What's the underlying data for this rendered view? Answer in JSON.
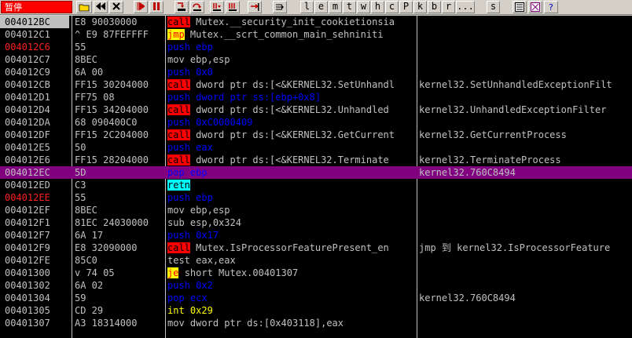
{
  "toolbar": {
    "status_label": "暂停",
    "letter_buttons": [
      "l",
      "e",
      "m",
      "t",
      "w",
      "h",
      "c",
      "P",
      "k",
      "b",
      "r",
      "...",
      "s"
    ]
  },
  "listing": {
    "rows": [
      {
        "addr": "004012BC",
        "hex": "E8 90030000",
        "mnemonic": "call",
        "operands": "Mutex.__security_init_cookietionsia",
        "comment": "",
        "addr_red": false,
        "selected": false,
        "kind": "call"
      },
      {
        "addr": "004012C1",
        "hex": "^ E9 87FEFFFF",
        "mnemonic": "jmp",
        "operands": "Mutex.__scrt_common_main_sehniniti",
        "comment": "",
        "addr_red": false,
        "selected": false,
        "kind": "jcc"
      },
      {
        "addr": "004012C6",
        "hex": "55",
        "mnemonic": "push",
        "operands": "ebp",
        "comment": "",
        "addr_red": true,
        "selected": false,
        "kind": "blue"
      },
      {
        "addr": "004012C7",
        "hex": "8BEC",
        "mnemonic": "mov",
        "operands": "ebp,esp",
        "comment": "",
        "addr_red": false,
        "selected": false,
        "kind": "std"
      },
      {
        "addr": "004012C9",
        "hex": "6A 00",
        "mnemonic": "push",
        "operands": "0x0",
        "comment": "",
        "addr_red": false,
        "selected": false,
        "kind": "blue"
      },
      {
        "addr": "004012CB",
        "hex": "FF15 30204000",
        "mnemonic": "call",
        "operands": "dword ptr ds:[<&KERNEL32.SetUnhandl",
        "comment": "kernel32.SetUnhandledExceptionFilt",
        "addr_red": false,
        "selected": false,
        "kind": "call"
      },
      {
        "addr": "004012D1",
        "hex": "FF75 08",
        "mnemonic": "push",
        "operands": "dword ptr ss:[ebp+0x8]",
        "comment": "",
        "addr_red": false,
        "selected": false,
        "kind": "blue"
      },
      {
        "addr": "004012D4",
        "hex": "FF15 34204000",
        "mnemonic": "call",
        "operands": "dword ptr ds:[<&KERNEL32.Unhandled",
        "comment": "kernel32.UnhandledExceptionFilter",
        "addr_red": false,
        "selected": false,
        "kind": "call"
      },
      {
        "addr": "004012DA",
        "hex": "68 090400C0",
        "mnemonic": "push",
        "operands": "0xC0000409",
        "comment": "",
        "addr_red": false,
        "selected": false,
        "kind": "blue"
      },
      {
        "addr": "004012DF",
        "hex": "FF15 2C204000",
        "mnemonic": "call",
        "operands": "dword ptr ds:[<&KERNEL32.GetCurrent",
        "comment": "kernel32.GetCurrentProcess",
        "addr_red": false,
        "selected": false,
        "kind": "call"
      },
      {
        "addr": "004012E5",
        "hex": "50",
        "mnemonic": "push",
        "operands": "eax",
        "comment": "",
        "addr_red": false,
        "selected": false,
        "kind": "blue"
      },
      {
        "addr": "004012E6",
        "hex": "FF15 28204000",
        "mnemonic": "call",
        "operands": "dword ptr ds:[<&KERNEL32.Terminate",
        "comment": "kernel32.TerminateProcess",
        "addr_red": false,
        "selected": false,
        "kind": "call"
      },
      {
        "addr": "004012EC",
        "hex": "5D",
        "mnemonic": "pop",
        "operands": "ebp",
        "comment": "kernel32.760C8494",
        "addr_red": false,
        "selected": true,
        "kind": "blue"
      },
      {
        "addr": "004012ED",
        "hex": "C3",
        "mnemonic": "retn",
        "operands": "",
        "comment": "",
        "addr_red": false,
        "selected": false,
        "kind": "ret"
      },
      {
        "addr": "004012EE",
        "hex": "55",
        "mnemonic": "push",
        "operands": "ebp",
        "comment": "",
        "addr_red": true,
        "selected": false,
        "kind": "blue"
      },
      {
        "addr": "004012EF",
        "hex": "8BEC",
        "mnemonic": "mov",
        "operands": "ebp,esp",
        "comment": "",
        "addr_red": false,
        "selected": false,
        "kind": "std"
      },
      {
        "addr": "004012F1",
        "hex": "81EC 24030000",
        "mnemonic": "sub",
        "operands": "esp,0x324",
        "comment": "",
        "addr_red": false,
        "selected": false,
        "kind": "std"
      },
      {
        "addr": "004012F7",
        "hex": "6A 17",
        "mnemonic": "push",
        "operands": "0x17",
        "comment": "",
        "addr_red": false,
        "selected": false,
        "kind": "blue"
      },
      {
        "addr": "004012F9",
        "hex": "E8 32090000",
        "mnemonic": "call",
        "operands": "Mutex.IsProcessorFeaturePresent_en",
        "comment": "jmp 到 kernel32.IsProcessorFeature",
        "addr_red": false,
        "selected": false,
        "kind": "call"
      },
      {
        "addr": "004012FE",
        "hex": "85C0",
        "mnemonic": "test",
        "operands": "eax,eax",
        "comment": "",
        "addr_red": false,
        "selected": false,
        "kind": "std"
      },
      {
        "addr": "00401300",
        "hex": "v 74 05",
        "mnemonic": "je",
        "operands": "short Mutex.00401307",
        "comment": "",
        "addr_red": false,
        "selected": false,
        "kind": "jcc"
      },
      {
        "addr": "00401302",
        "hex": "6A 02",
        "mnemonic": "push",
        "operands": "0x2",
        "comment": "",
        "addr_red": false,
        "selected": false,
        "kind": "blue"
      },
      {
        "addr": "00401304",
        "hex": "59",
        "mnemonic": "pop",
        "operands": "ecx",
        "comment": "kernel32.760C8494",
        "addr_red": false,
        "selected": false,
        "kind": "blue"
      },
      {
        "addr": "00401305",
        "hex": "CD 29",
        "mnemonic": "int",
        "operands": "0x29",
        "comment": "",
        "addr_red": false,
        "selected": false,
        "kind": "int"
      },
      {
        "addr": "00401307",
        "hex": "A3 18314000",
        "mnemonic": "mov",
        "operands": "dword ptr ds:[0x403118],eax",
        "comment": "",
        "addr_red": false,
        "selected": false,
        "kind": "std"
      }
    ]
  }
}
